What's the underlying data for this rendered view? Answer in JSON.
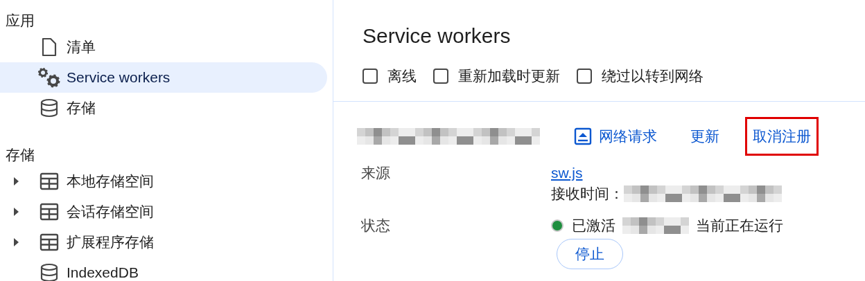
{
  "sidebar": {
    "sections": [
      {
        "title": "应用",
        "items": [
          {
            "label": "清单",
            "kind": "file",
            "expandable": false,
            "selected": false
          },
          {
            "label": "Service workers",
            "kind": "workers",
            "expandable": false,
            "selected": true
          },
          {
            "label": "存储",
            "kind": "storage",
            "expandable": false,
            "selected": false
          }
        ]
      },
      {
        "title": "存储",
        "items": [
          {
            "label": "本地存储空间",
            "kind": "table",
            "expandable": true,
            "selected": false
          },
          {
            "label": "会话存储空间",
            "kind": "table",
            "expandable": true,
            "selected": false
          },
          {
            "label": "扩展程序存储",
            "kind": "table",
            "expandable": true,
            "selected": false
          },
          {
            "label": "IndexedDB",
            "kind": "storage",
            "expandable": false,
            "selected": false
          }
        ]
      }
    ]
  },
  "main": {
    "title": "Service workers",
    "options": [
      {
        "label": "离线",
        "checked": false
      },
      {
        "label": "重新加载时更新",
        "checked": false
      },
      {
        "label": "绕过以转到网络",
        "checked": false
      }
    ],
    "actions": [
      {
        "label": "网络请求",
        "kind": "network",
        "highlighted": false
      },
      {
        "label": "更新",
        "kind": "plain",
        "highlighted": false
      },
      {
        "label": "取消注册",
        "kind": "plain",
        "highlighted": true
      }
    ],
    "source": {
      "label": "来源",
      "link": "sw.js",
      "received_label": "接收时间："
    },
    "status": {
      "label": "状态",
      "color": "#1e8e3e",
      "state": "已激活",
      "running": "当前正在运行",
      "stop_button": "停止"
    }
  }
}
